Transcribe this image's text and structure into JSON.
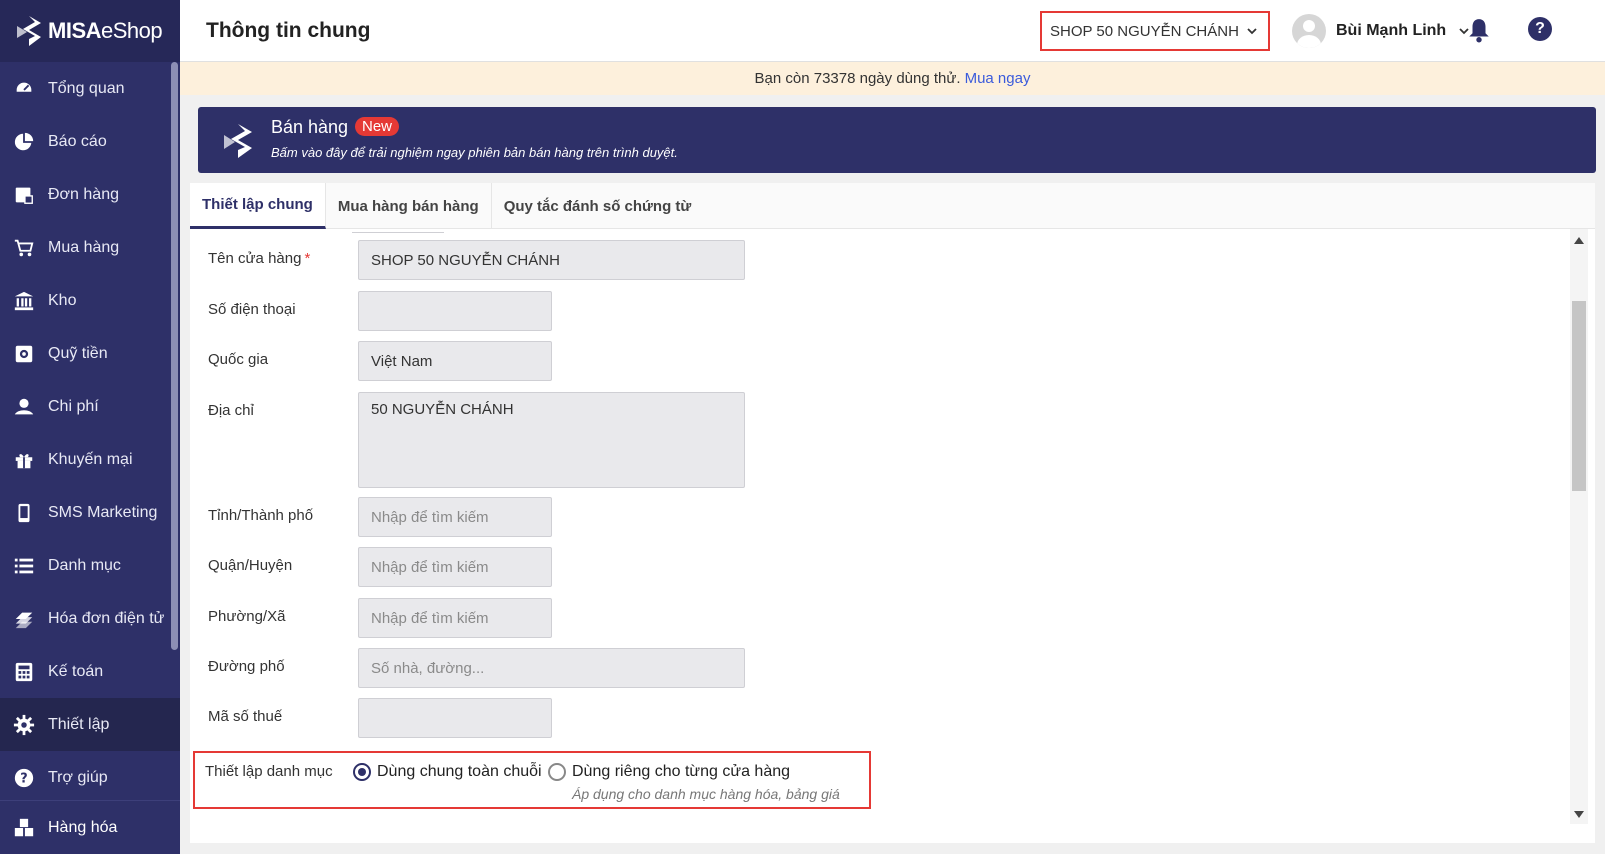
{
  "brand": {
    "name_bold": "MISA",
    "name_light": "eShop"
  },
  "sidebar": {
    "items": [
      {
        "label": "Tổng quan",
        "icon": "dashboard-icon"
      },
      {
        "label": "Báo cáo",
        "icon": "pie-chart-icon"
      },
      {
        "label": "Đơn hàng",
        "icon": "order-icon"
      },
      {
        "label": "Mua hàng",
        "icon": "cart-icon"
      },
      {
        "label": "Kho",
        "icon": "warehouse-icon"
      },
      {
        "label": "Quỹ tiền",
        "icon": "safe-icon"
      },
      {
        "label": "Chi phí",
        "icon": "expense-icon"
      },
      {
        "label": "Khuyến mại",
        "icon": "gift-icon"
      },
      {
        "label": "SMS Marketing",
        "icon": "phone-icon"
      },
      {
        "label": "Danh mục",
        "icon": "list-icon"
      },
      {
        "label": "Hóa đơn điện tử",
        "icon": "invoice-icon"
      },
      {
        "label": "Kế toán",
        "icon": "calculator-icon"
      },
      {
        "label": "Thiết lập",
        "icon": "gear-icon",
        "active": true
      },
      {
        "label": "Trợ giúp",
        "icon": "help-icon"
      }
    ],
    "bottom": {
      "label": "Hàng hóa",
      "icon": "boxes-icon"
    }
  },
  "header": {
    "title": "Thông tin chung",
    "shop": "SHOP 50 NGUYỄN CHÁNH",
    "user": "Bùi Mạnh Linh"
  },
  "trial": {
    "text": "Bạn còn 73378 ngày dùng thử.",
    "link": "Mua ngay"
  },
  "banner": {
    "title": "Bán hàng",
    "badge": "New",
    "subtitle": "Bấm vào đây để trải nghiệm ngay phiên bản bán hàng trên trình duyệt."
  },
  "tabs": [
    {
      "label": "Thiết lập chung",
      "active": true
    },
    {
      "label": "Mua hàng bán hàng"
    },
    {
      "label": "Quy tắc đánh số chứng từ"
    }
  ],
  "form": {
    "store_name": {
      "label": "Tên cửa hàng",
      "required": "*",
      "value": "SHOP 50 NGUYỄN CHÁNH"
    },
    "phone": {
      "label": "Số điện thoại",
      "value": ""
    },
    "country": {
      "label": "Quốc gia",
      "value": "Việt Nam"
    },
    "address": {
      "label": "Địa chỉ",
      "value": "50 NGUYỄN CHÁNH"
    },
    "province": {
      "label": "Tỉnh/Thành phố",
      "placeholder": "Nhập để tìm kiếm"
    },
    "district": {
      "label": "Quận/Huyện",
      "placeholder": "Nhập để tìm kiếm"
    },
    "ward": {
      "label": "Phường/Xã",
      "placeholder": "Nhập để tìm kiếm"
    },
    "street": {
      "label": "Đường phố",
      "placeholder": "Số nhà, đường..."
    },
    "tax": {
      "label": "Mã số thuế",
      "value": ""
    },
    "catalog": {
      "label": "Thiết lập danh mục",
      "option_shared": "Dùng chung toàn chuỗi",
      "option_separate": "Dùng riêng cho từng cửa hàng",
      "hint": "Áp dụng cho danh mục hàng hóa, bảng giá",
      "selected": "shared"
    }
  },
  "colors": {
    "sidebar": "#2e3068",
    "accent": "#2e3068",
    "highlight": "#e53935",
    "trial_bg": "#fdf0dc"
  }
}
